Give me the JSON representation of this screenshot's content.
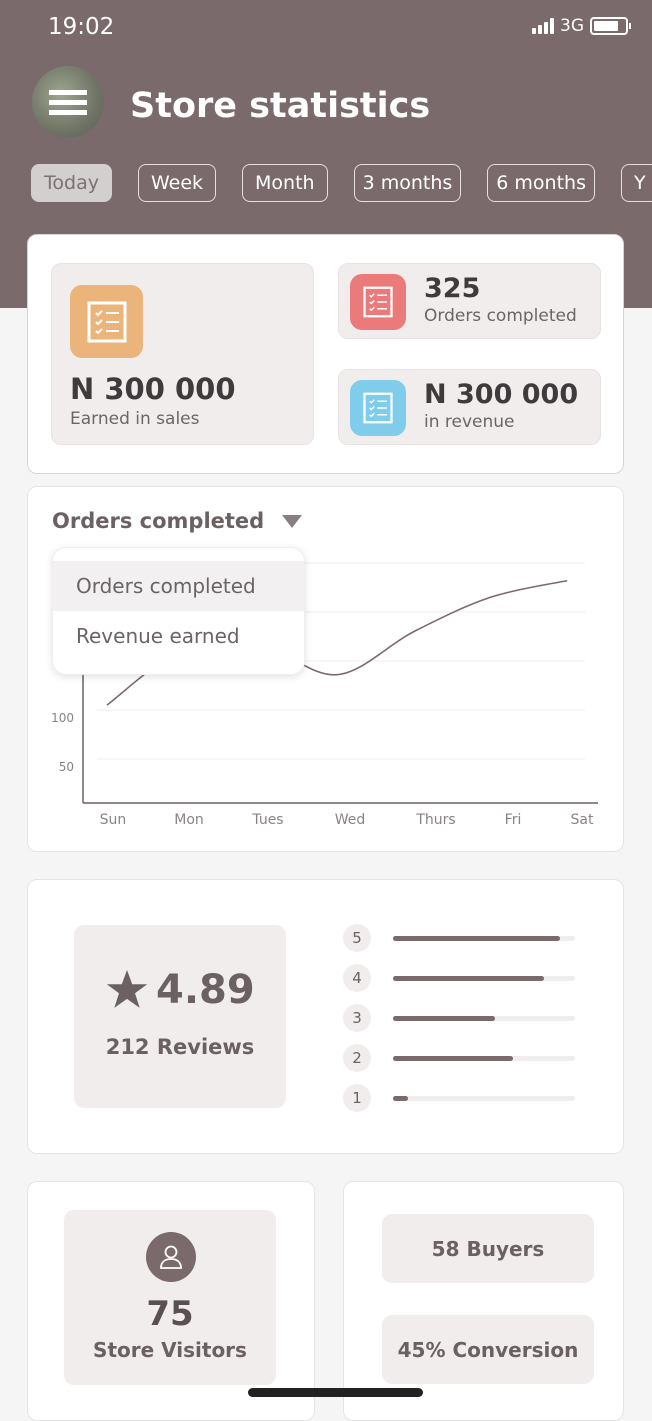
{
  "status_bar": {
    "time": "19:02",
    "network": "3G",
    "battery_level": 0.8
  },
  "header": {
    "title": "Store statistics",
    "menu_icon": "hamburger-icon"
  },
  "period_tabs": [
    {
      "label": "Today",
      "active": true
    },
    {
      "label": "Week"
    },
    {
      "label": "Month"
    },
    {
      "label": "3 months"
    },
    {
      "label": "6 months"
    },
    {
      "label": "Y"
    }
  ],
  "summary": {
    "sales": {
      "value": "N 300 000",
      "label": "Earned in sales",
      "icon": "checklist-icon",
      "color": "#ebb47a"
    },
    "orders": {
      "value": "325",
      "label": "Orders completed",
      "icon": "checklist-icon",
      "color": "#eb7b7b"
    },
    "revenue": {
      "value": "N 300 000",
      "label": "in revenue",
      "icon": "checklist-icon",
      "color": "#7fcdea"
    }
  },
  "chart_section": {
    "dropdown_selected": "Orders completed",
    "dropdown_options": [
      "Orders completed",
      "Revenue earned"
    ]
  },
  "chart_data": {
    "type": "line",
    "categories": [
      "Sun",
      "Mon",
      "Tues",
      "Wed",
      "Thurs",
      "Fri",
      "Sat"
    ],
    "values": [
      105,
      162,
      166,
      136,
      180,
      215,
      232
    ],
    "y_ticks": [
      50,
      100
    ],
    "grid": true,
    "color": "#7b6a6b"
  },
  "ratings": {
    "average": "4.89",
    "reviews": "212 Reviews",
    "distribution": [
      {
        "star": "5",
        "fraction": 0.92
      },
      {
        "star": "4",
        "fraction": 0.83
      },
      {
        "star": "3",
        "fraction": 0.56
      },
      {
        "star": "2",
        "fraction": 0.66
      },
      {
        "star": "1",
        "fraction": 0.08
      }
    ]
  },
  "visitors": {
    "value": "75",
    "label": "Store Visitors",
    "icon": "user-icon"
  },
  "conversion": {
    "buyers": "58 Buyers",
    "rate": "45% Conversion"
  }
}
